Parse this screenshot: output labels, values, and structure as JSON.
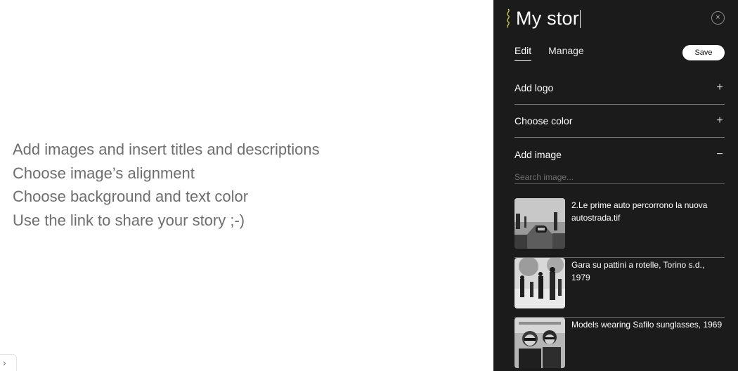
{
  "instructions": [
    "Add images and insert titles and descriptions",
    "Choose image’s alignment",
    "Choose background and text color",
    "Use the link to share your story ;-)"
  ],
  "sidebar_toggle": {
    "icon": "chevron-right-icon",
    "glyph": "›"
  },
  "panel": {
    "title": "My stor",
    "close_icon": "close-icon",
    "close_glyph": "×",
    "tabs": [
      {
        "label": "Edit",
        "active": true
      },
      {
        "label": "Manage",
        "active": false
      }
    ],
    "save_label": "Save",
    "sections": [
      {
        "label": "Add logo",
        "icon": "plus-icon",
        "glyph": "+",
        "expanded": false
      },
      {
        "label": "Choose color",
        "icon": "plus-icon",
        "glyph": "+",
        "expanded": false
      },
      {
        "label": "Add image",
        "icon": "minus-icon",
        "glyph": "−",
        "expanded": true
      }
    ],
    "search_placeholder": "Search image...",
    "results": [
      {
        "caption": "2.Le prime auto percorrono la nuova autostrada.tif"
      },
      {
        "caption": "Gara su pattini a rotelle, Torino s.d., 1979"
      },
      {
        "caption": "Models wearing Safilo sunglasses, 1969"
      }
    ]
  },
  "colors": {
    "panel_bg": "#1b1b1b",
    "accent_squiggle": "#d4d23a",
    "instruction_text": "#6e6e6e"
  }
}
